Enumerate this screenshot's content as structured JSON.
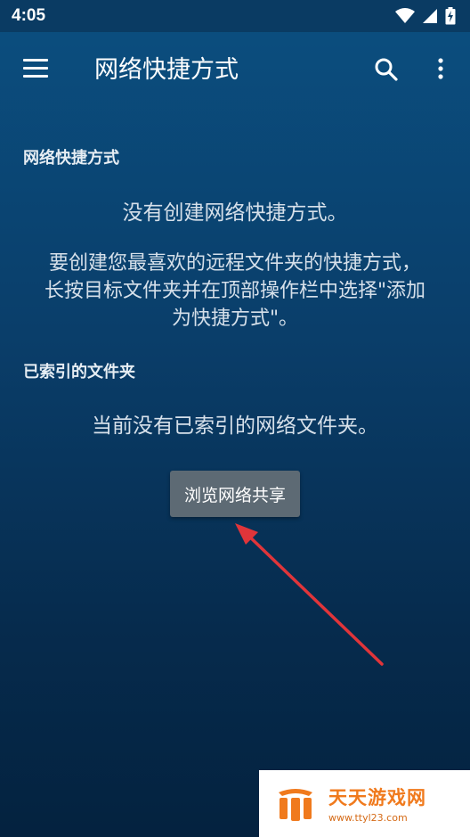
{
  "status_bar": {
    "time": "4:05"
  },
  "app_bar": {
    "title": "网络快捷方式"
  },
  "shortcuts_section": {
    "heading": "网络快捷方式",
    "empty_message": "没有创建网络快捷方式。",
    "hint_lines": [
      "要创建您最喜欢的远程文件夹的快捷方式，",
      "长按目标文件夹并在顶部操作栏中选择\"添加",
      "为快捷方式\"。"
    ]
  },
  "indexed_section": {
    "heading": "已索引的文件夹",
    "empty_message": "当前没有已索引的网络文件夹。"
  },
  "browse_button": {
    "label": "浏览网络共享"
  },
  "watermark": {
    "title": "天天游戏网",
    "url": "www.ttyl23.com"
  },
  "colors": {
    "background": "#0a3e6a",
    "button": "#5d6a74",
    "arrow": "#e0353a",
    "watermark_accent": "#f07a1d"
  }
}
